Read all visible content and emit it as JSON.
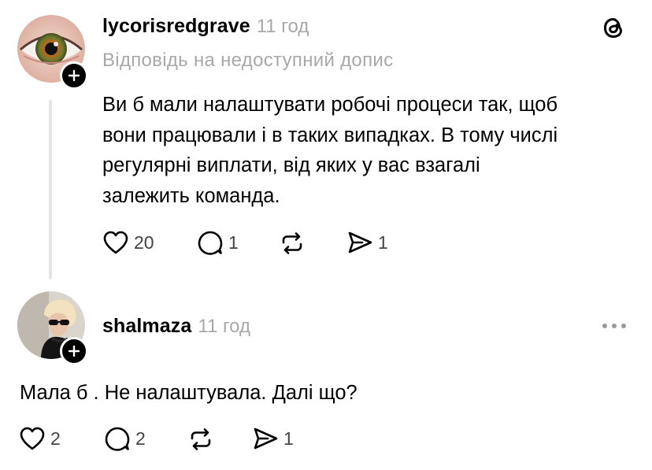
{
  "posts": [
    {
      "username": "lycorisredgrave",
      "time": "11 год",
      "reply_note": "Відповідь на недоступний допис",
      "text_lines": [
        "Ви б мали налаштувати робочі процеси так, щоб",
        "вони працювали і в таких випадках. В тому числі",
        "регулярні виплати, від яких у вас взагалі",
        "залежить команда."
      ],
      "likes": "20",
      "replies": "1",
      "shares": "1"
    },
    {
      "username": "shalmaza",
      "time": "11 год",
      "text": "Мала б . Не налаштувала. Далі що?",
      "likes": "2",
      "replies": "2",
      "shares": "1"
    }
  ],
  "icons": {
    "app_logo": "threads-logo-icon",
    "more": "more-horizontal-icon",
    "like": "heart-icon",
    "reply": "comment-icon",
    "repost": "repost-icon",
    "share": "send-icon",
    "follow": "plus-icon"
  }
}
